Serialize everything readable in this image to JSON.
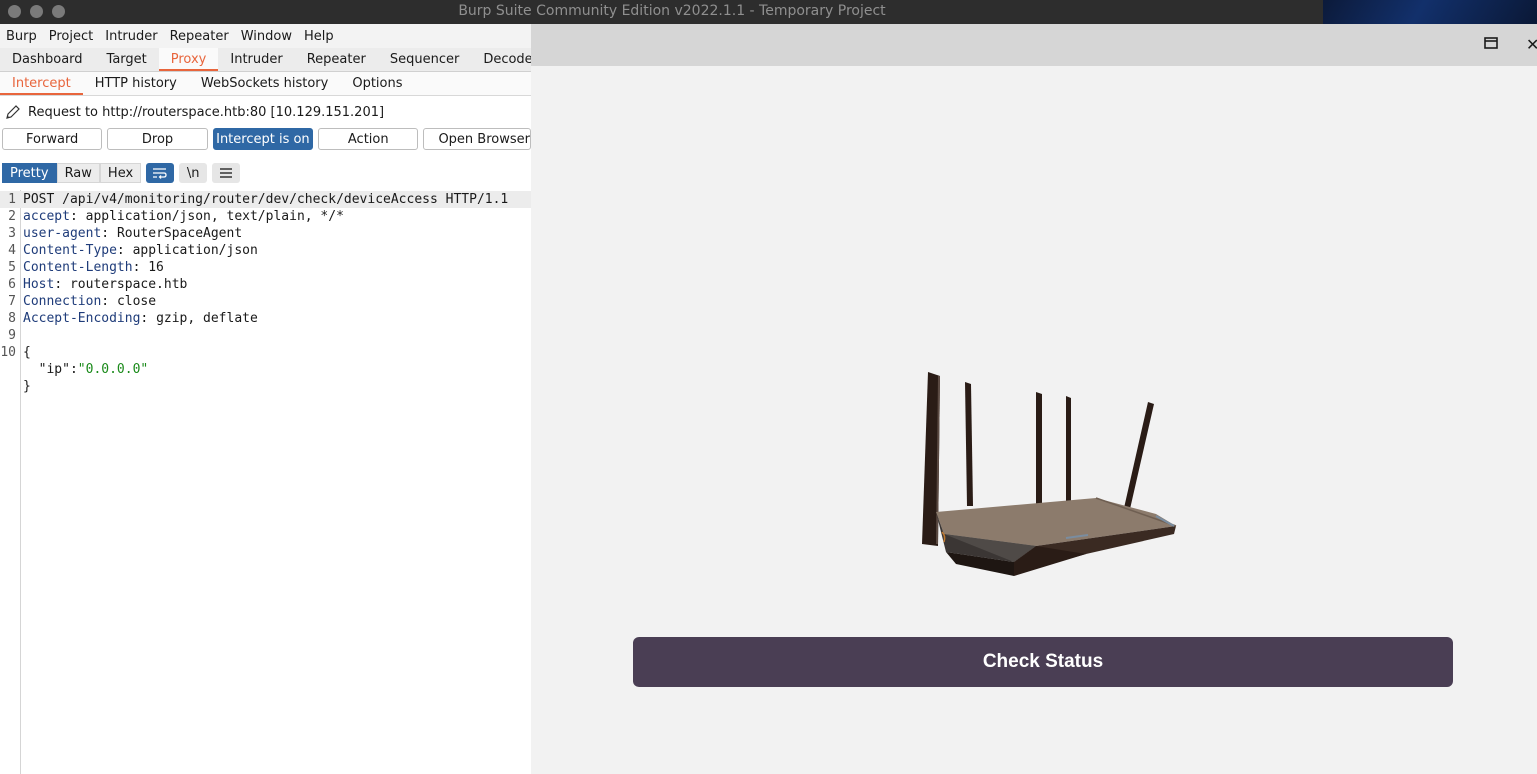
{
  "window": {
    "title": "Burp Suite Community Edition v2022.1.1 - Temporary Project"
  },
  "menu": [
    "Burp",
    "Project",
    "Intruder",
    "Repeater",
    "Window",
    "Help"
  ],
  "main_tabs": [
    "Dashboard",
    "Target",
    "Proxy",
    "Intruder",
    "Repeater",
    "Sequencer",
    "Decoder"
  ],
  "main_tabs_active": "Proxy",
  "proxy_tabs": [
    "Intercept",
    "HTTP history",
    "WebSockets history",
    "Options"
  ],
  "proxy_tabs_active": "Intercept",
  "intercept": {
    "request_label": "Request to http://routerspace.htb:80  [10.129.151.201]",
    "forward": "Forward",
    "drop": "Drop",
    "intercept_toggle": "Intercept is on",
    "action": "Action",
    "open_browser": "Open Browser"
  },
  "view_tabs": [
    "Pretty",
    "Raw",
    "Hex"
  ],
  "view_tabs_active": "Pretty",
  "view_icons": {
    "newline": "\\n"
  },
  "request_lines": [
    {
      "num": "1",
      "key": "",
      "sep": "",
      "val": "POST /api/v4/monitoring/router/dev/check/deviceAccess HTTP/1.1"
    },
    {
      "num": "2",
      "key": "accept",
      "sep": ": ",
      "val": "application/json, text/plain, */*"
    },
    {
      "num": "3",
      "key": "user-agent",
      "sep": ": ",
      "val": "RouterSpaceAgent"
    },
    {
      "num": "4",
      "key": "Content-Type",
      "sep": ": ",
      "val": "application/json"
    },
    {
      "num": "5",
      "key": "Content-Length",
      "sep": ": ",
      "val": "16"
    },
    {
      "num": "6",
      "key": "Host",
      "sep": ": ",
      "val": "routerspace.htb"
    },
    {
      "num": "7",
      "key": "Connection",
      "sep": ": ",
      "val": "close"
    },
    {
      "num": "8",
      "key": "Accept-Encoding",
      "sep": ": ",
      "val": "gzip, deflate"
    },
    {
      "num": "9",
      "key": "",
      "sep": "",
      "val": ""
    },
    {
      "num": "10",
      "key": "",
      "sep": "",
      "val": "{"
    },
    {
      "num": "",
      "key": "  \"ip\"",
      "sep": ":",
      "val": "\"0.0.0.0\"",
      "json": true
    },
    {
      "num": "",
      "key": "",
      "sep": "",
      "val": "}"
    }
  ],
  "app": {
    "check_status": "Check Status"
  },
  "colors": {
    "accent_orange": "#e8653c",
    "primary_blue": "#2f68a5",
    "app_button": "#4a3e54"
  }
}
